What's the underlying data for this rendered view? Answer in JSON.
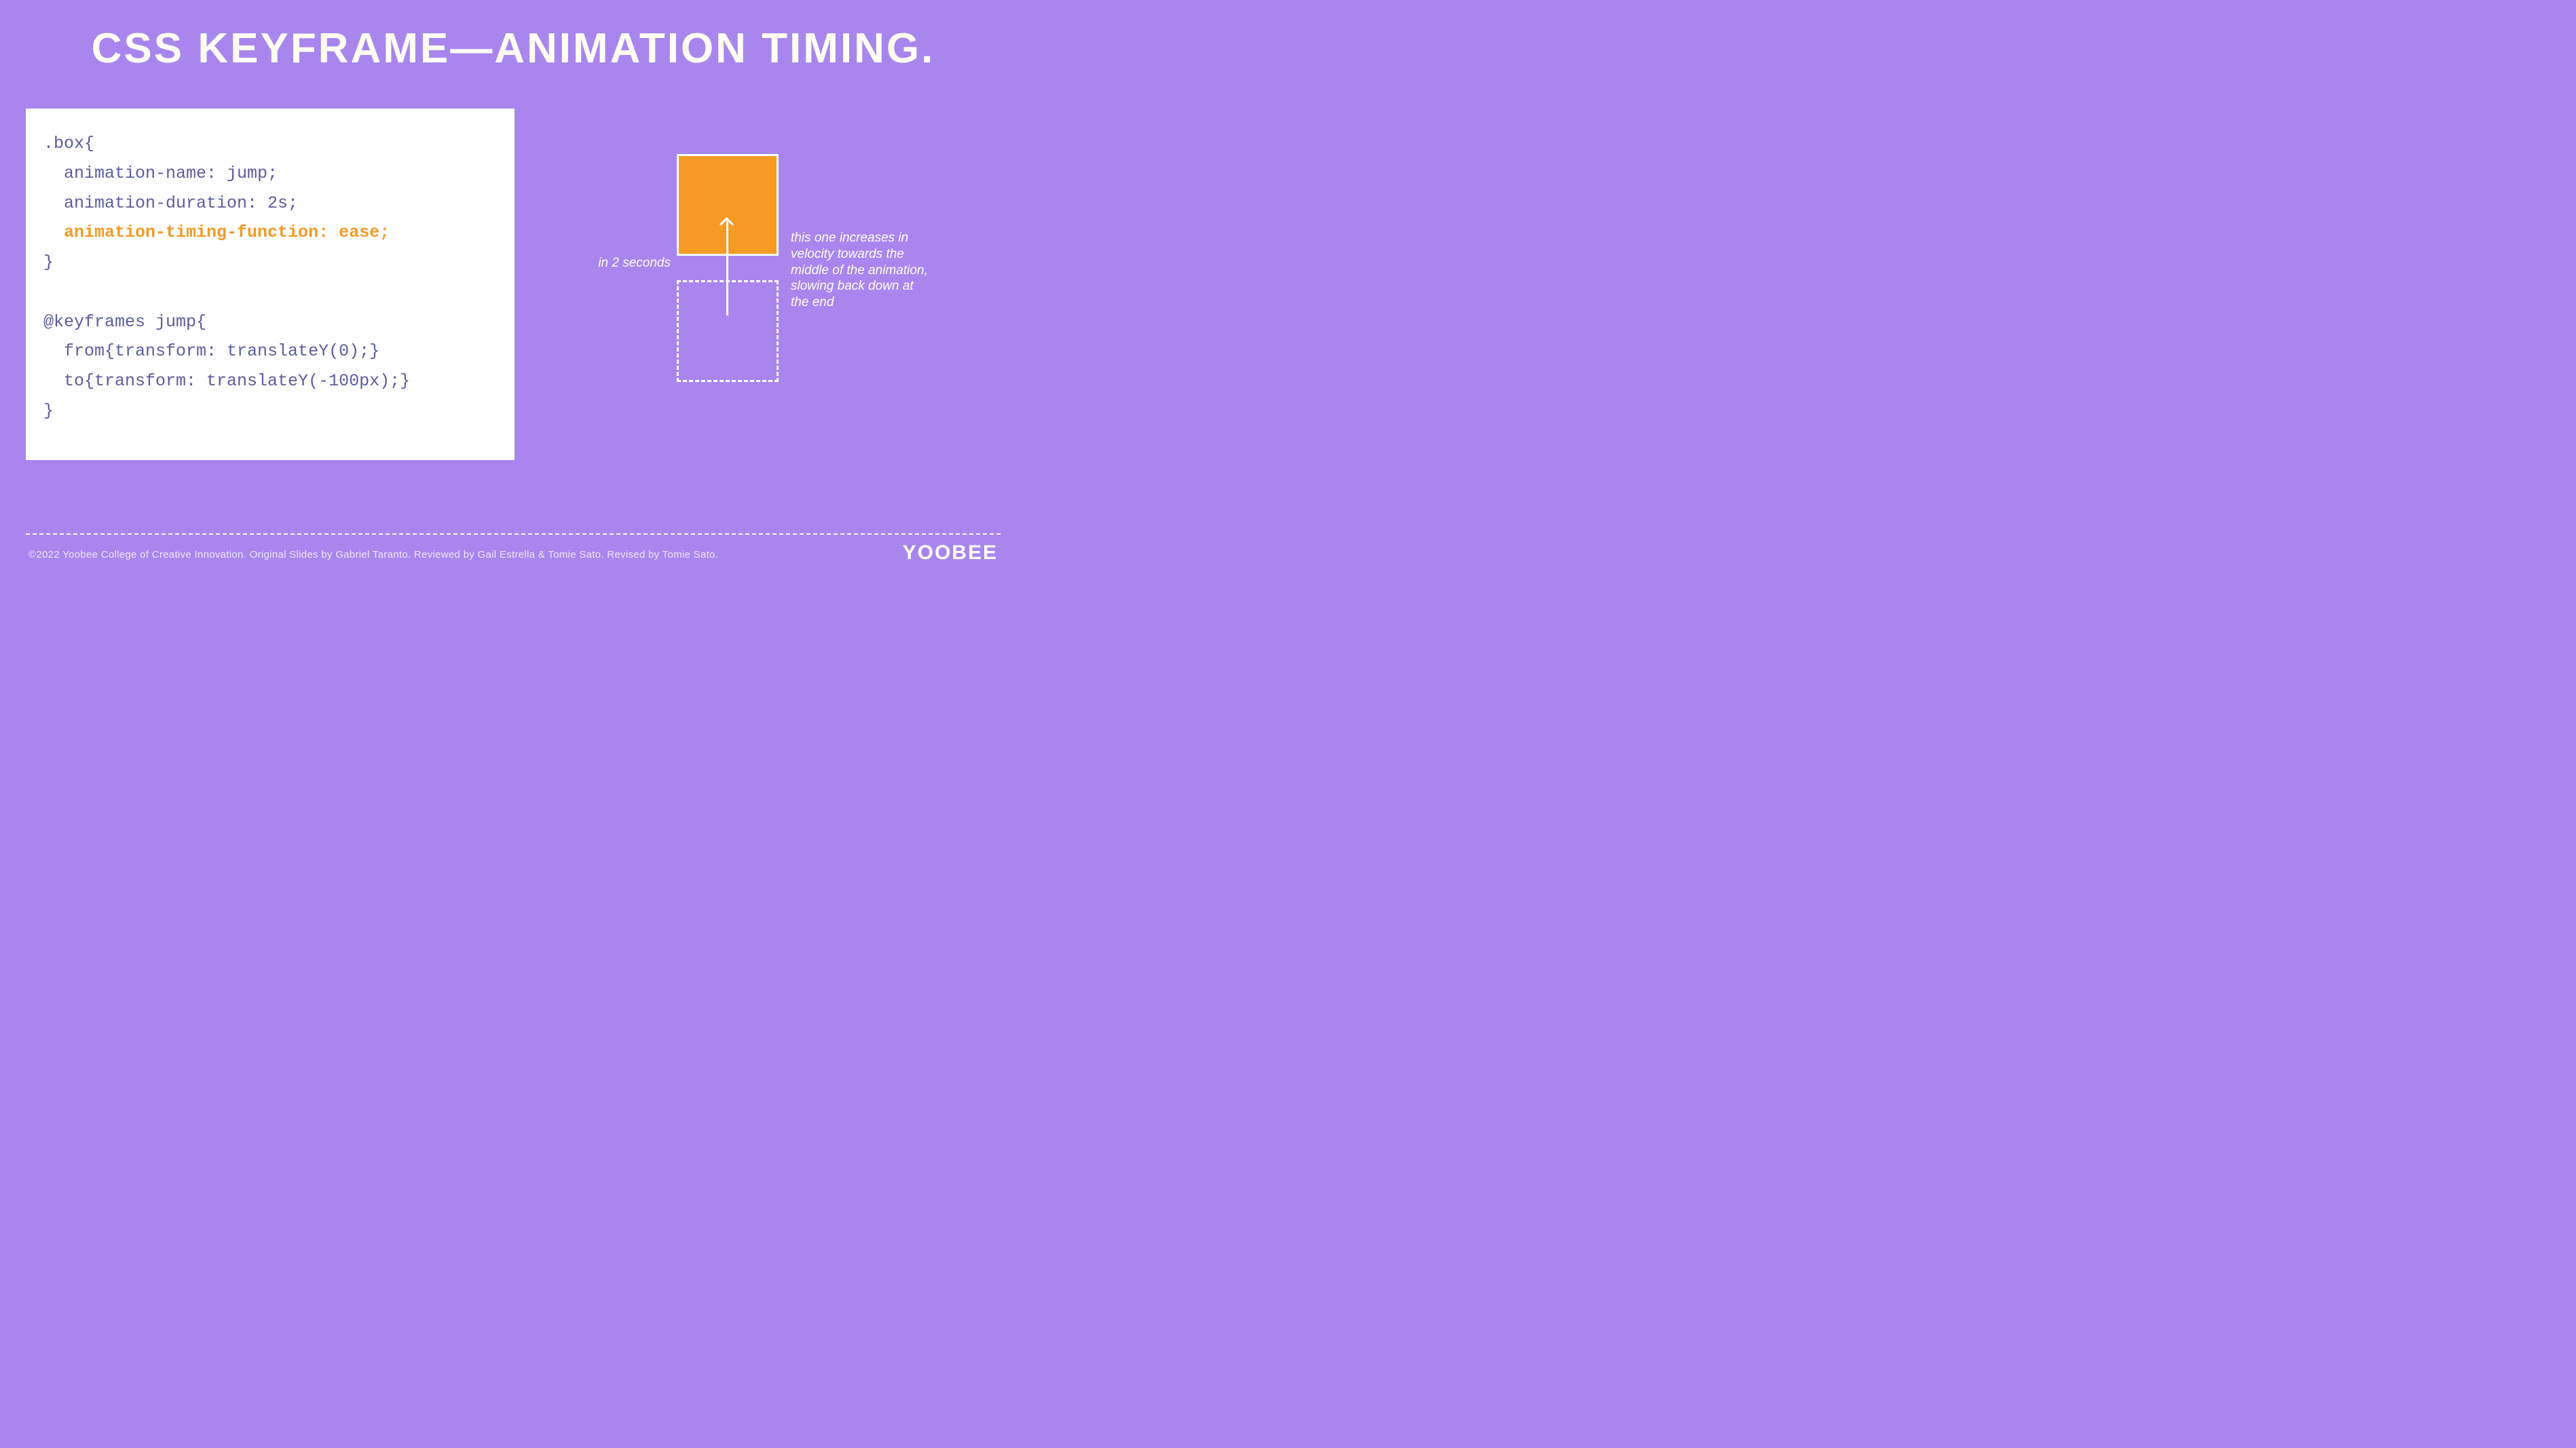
{
  "title": "CSS KEYFRAME—ANIMATION TIMING.",
  "code": {
    "line1": ".box{",
    "line2": "  animation-name: jump;",
    "line3": "  animation-duration: 2s;",
    "line4": "  animation-timing-function: ease;",
    "line5": "}",
    "line6": "",
    "line7": "@keyframes jump{",
    "line8": "  from{transform: translateY(0);}",
    "line9": "  to{transform: translateY(-100px);}",
    "line10": "}"
  },
  "diagram": {
    "left_label": "in 2 seconds",
    "right_label": "this one increases  in velocity towards  the middle of the animation, slowing back down at the end"
  },
  "footer": "©2022 Yoobee College of Creative Innovation.  Original Slides by Gabriel Taranto.  Reviewed by Gail Estrella & Tomie Sato.  Revised by Tomie Sato.",
  "brand": "YOOBEE"
}
